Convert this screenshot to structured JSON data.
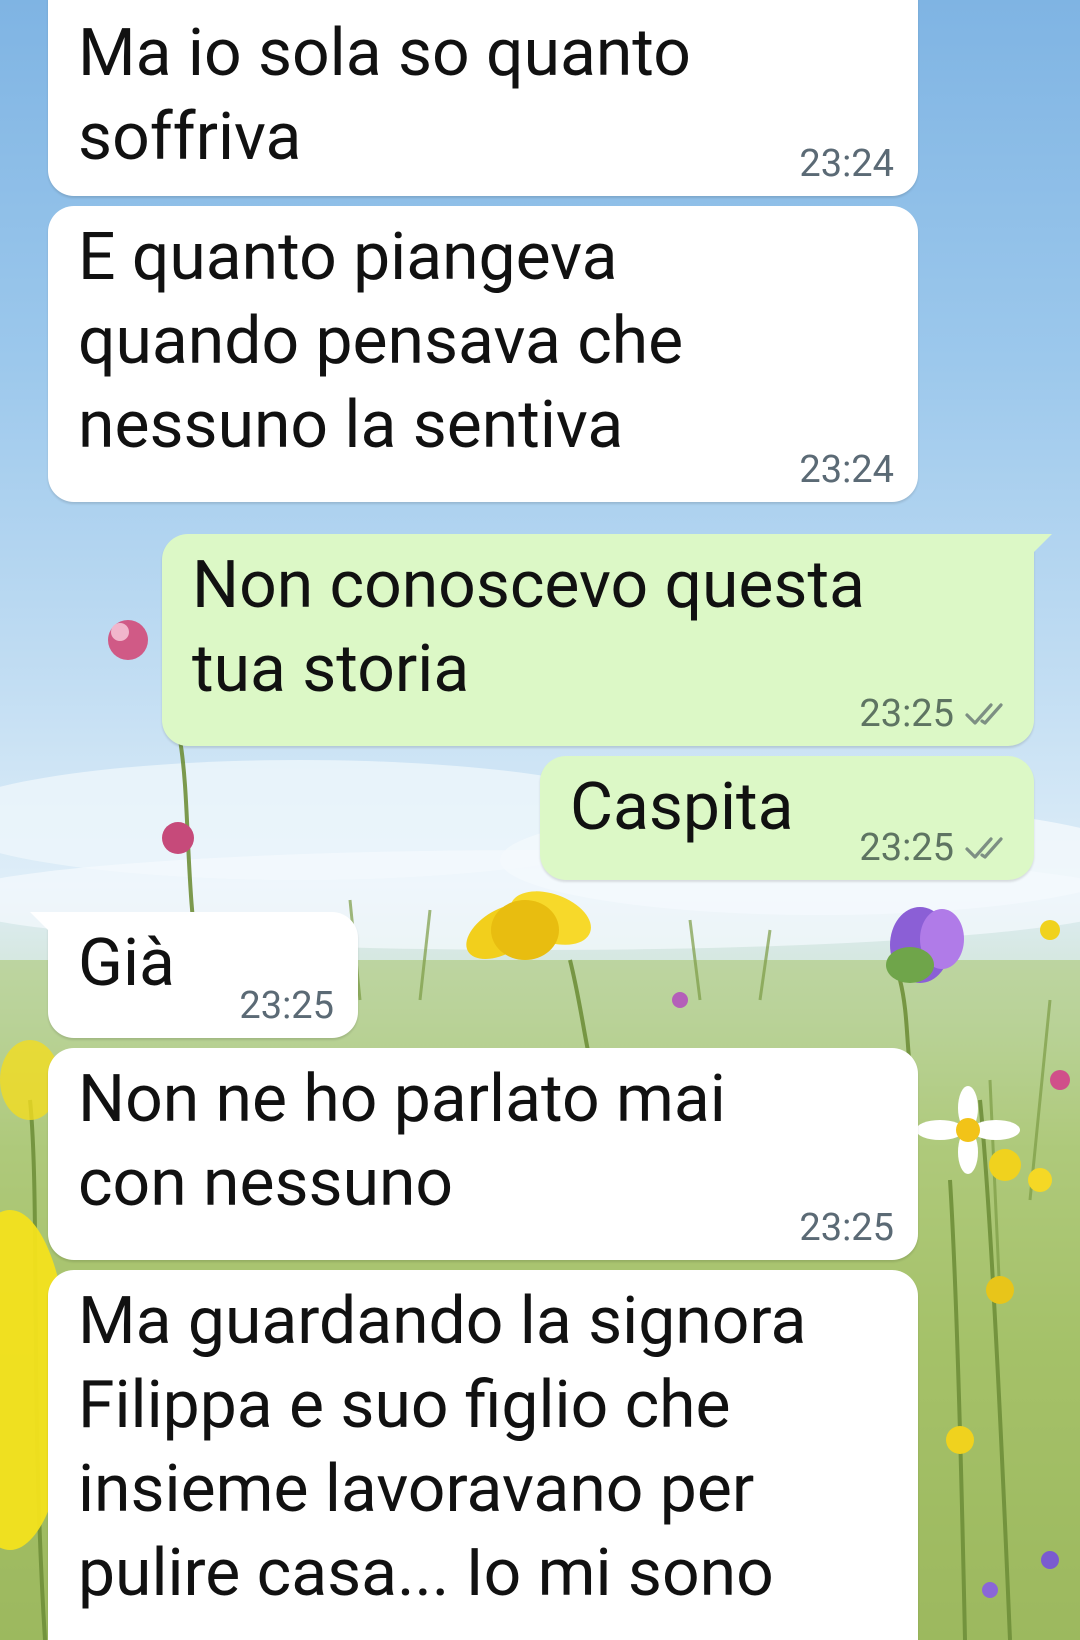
{
  "wallpaper": {
    "icon": "flower-meadow-wallpaper",
    "sky_color": "#8fc1e8",
    "grass_color": "#9ab65a"
  },
  "colors": {
    "incoming_bubble": "#ffffff",
    "outgoing_bubble": "#dcf8c6",
    "text": "#111111",
    "timestamp": "#5b6a75"
  },
  "messages": [
    {
      "direction": "incoming",
      "text": "Ma io sola so quanto\nsoffriva",
      "time": "23:24"
    },
    {
      "direction": "incoming",
      "text": "E quanto piangeva\nquando pensava che\nnessuno la sentiva",
      "time": "23:24"
    },
    {
      "direction": "outgoing",
      "text": "Non conoscevo questa\ntua storia",
      "time": "23:25",
      "status": "read-ticks"
    },
    {
      "direction": "outgoing",
      "text": "Caspita",
      "time": "23:25",
      "status": "read-ticks"
    },
    {
      "direction": "incoming",
      "text": "Già",
      "time": "23:25"
    },
    {
      "direction": "incoming",
      "text": "Non ne ho parlato mai\ncon nessuno",
      "time": "23:25"
    },
    {
      "direction": "incoming",
      "text": "Ma guardando la signora\nFilippa e suo figlio che\ninsieme lavoravano per\npulire casa... Io mi sono",
      "time": ""
    }
  ]
}
